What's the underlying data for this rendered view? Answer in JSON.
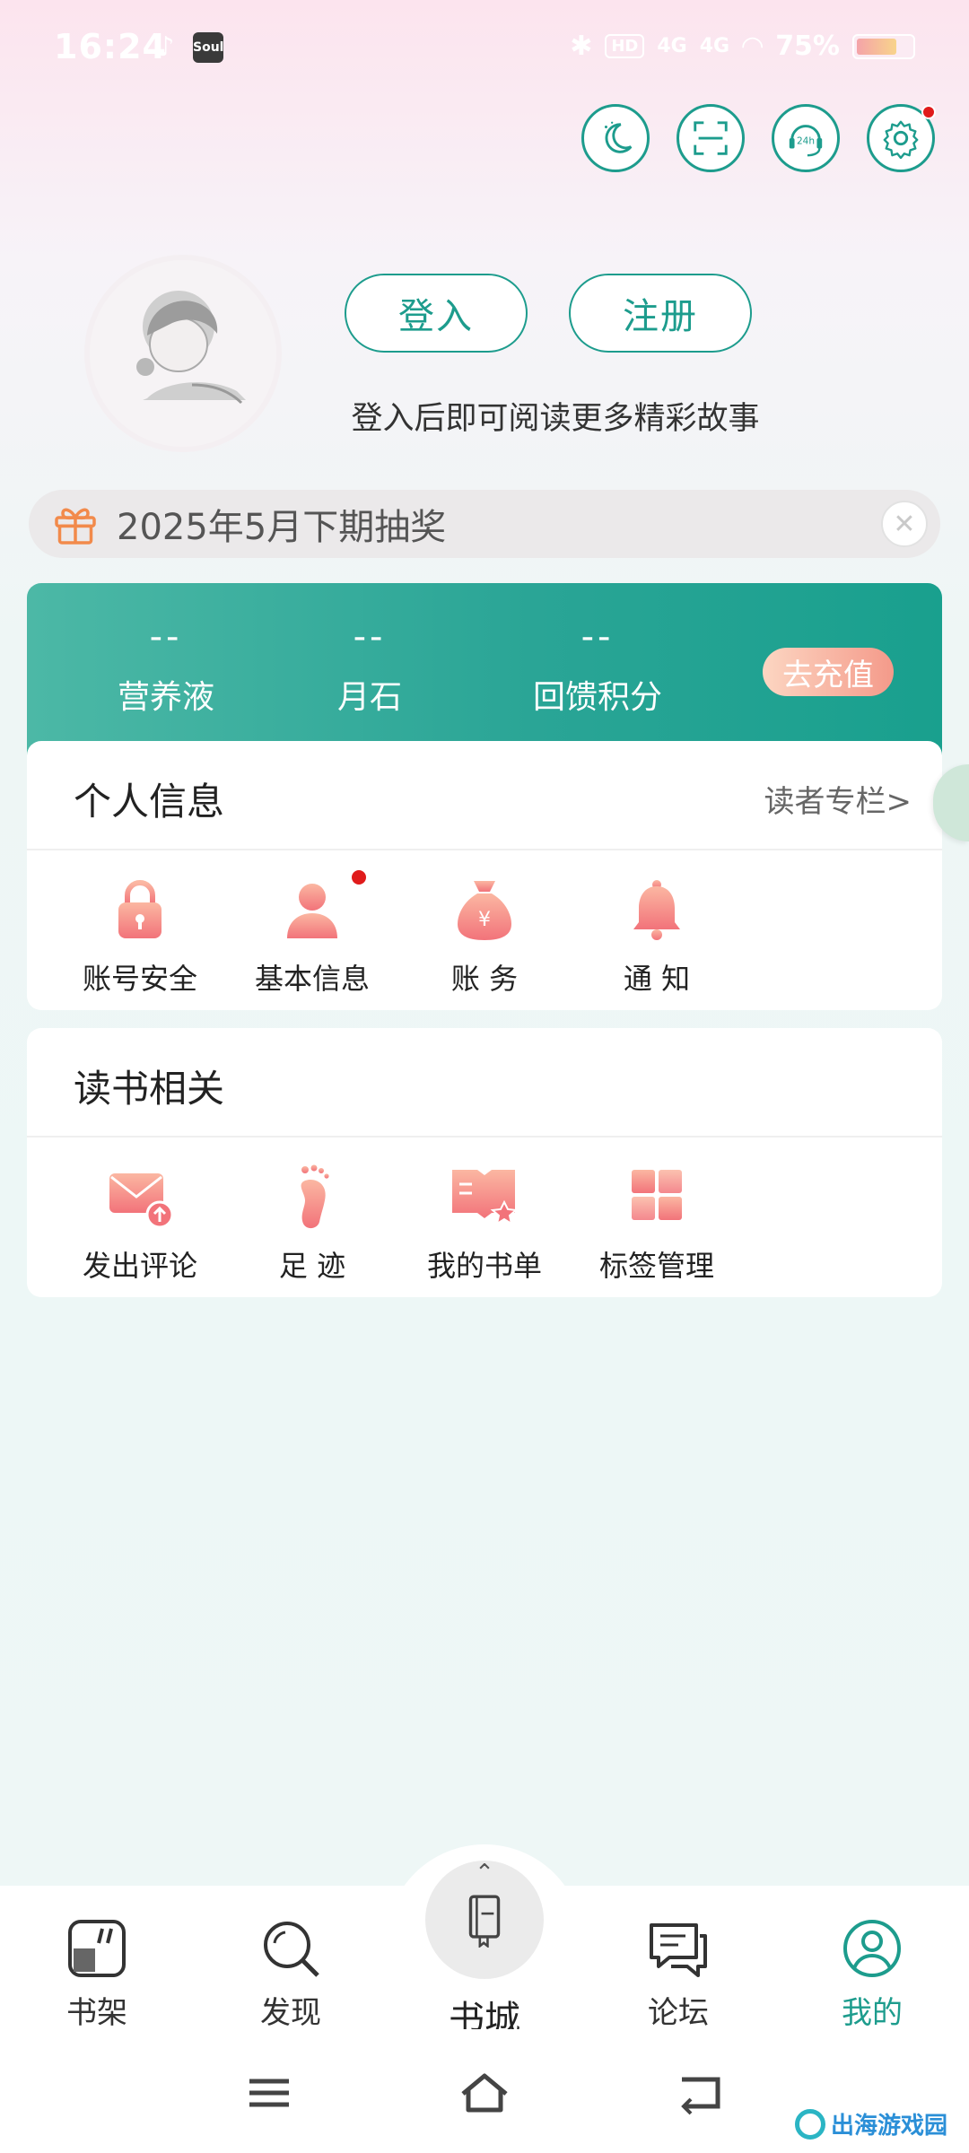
{
  "status_bar": {
    "time": "16:24",
    "tiktok_icon": "tiktok-icon",
    "soul_label": "Soul",
    "hd_label": "HD",
    "signal_1": "4G",
    "signal_2": "4G",
    "battery_text": "75%",
    "battery_level": 0.75
  },
  "top_actions": [
    "moon-icon",
    "scan-icon",
    "customer-service-icon",
    "settings-icon"
  ],
  "profile": {
    "login_label": "登入",
    "register_label": "注册",
    "hint": "登入后即可阅读更多精彩故事"
  },
  "lottery": {
    "label": "2025年5月下期抽奖",
    "close_icon": "close-icon"
  },
  "stats": {
    "items": [
      {
        "value": "--",
        "label": "营养液"
      },
      {
        "value": "--",
        "label": "月石"
      },
      {
        "value": "--",
        "label": "回馈积分"
      }
    ],
    "recharge_label": "去充值"
  },
  "personal": {
    "title": "个人信息",
    "link": "读者专栏>",
    "items": [
      {
        "label": "账号安全",
        "icon": "lock-icon"
      },
      {
        "label": "基本信息",
        "icon": "user-icon"
      },
      {
        "label": "账  务",
        "icon": "money-bag-icon"
      },
      {
        "label": "通  知",
        "icon": "bell-icon"
      }
    ]
  },
  "reading": {
    "title": "读书相关",
    "items": [
      {
        "label": "发出评论",
        "icon": "envelope-icon"
      },
      {
        "label": "足  迹",
        "icon": "footprint-icon"
      },
      {
        "label": "我的书单",
        "icon": "booklist-icon"
      },
      {
        "label": "标签管理",
        "icon": "tags-icon"
      }
    ]
  },
  "bottom_nav": {
    "items": [
      {
        "label": "书架",
        "icon": "bookshelf-icon"
      },
      {
        "label": "发现",
        "icon": "search-icon"
      },
      {
        "label": "书城",
        "icon": "book-icon"
      },
      {
        "label": "论坛",
        "icon": "chat-icon"
      },
      {
        "label": "我的",
        "icon": "profile-icon"
      }
    ],
    "active": "我的"
  },
  "colors": {
    "accent": "#1d9c8d",
    "icon_gradient_top": "#fbb7a2",
    "icon_gradient_bottom": "#f2737a",
    "badge": "#e01b1b"
  },
  "watermark": "出海游戏园"
}
